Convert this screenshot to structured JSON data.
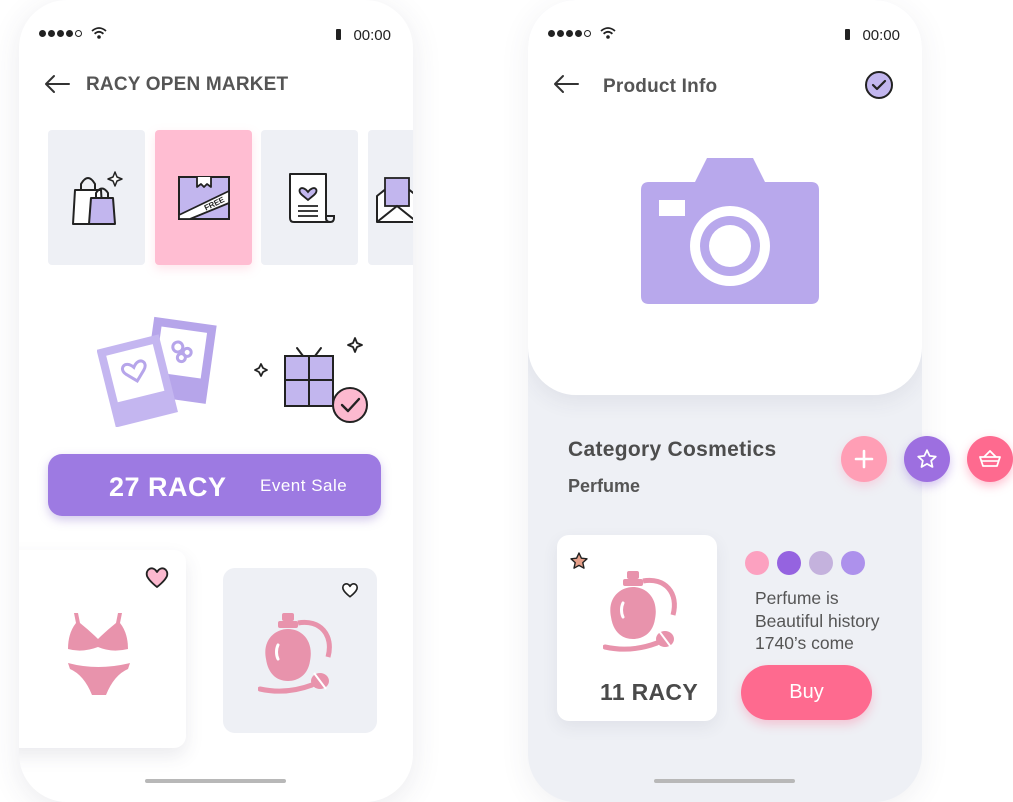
{
  "status_bar": {
    "time": "00:00"
  },
  "market_screen": {
    "title": "RACY OPEN MARKET",
    "categories": [
      {
        "icon": "shopping-bags-icon"
      },
      {
        "icon": "free-box-icon",
        "selected": true
      },
      {
        "icon": "love-letter-icon"
      },
      {
        "icon": "envelope-icon"
      }
    ],
    "promo": {
      "amount": "27 RACY",
      "label": "Event Sale"
    },
    "products": [
      {
        "icon": "bikini-icon",
        "liked": true
      },
      {
        "icon": "perfume-icon",
        "liked": false
      }
    ]
  },
  "product_screen": {
    "title": "Product Info",
    "category_title": "Category Cosmetics",
    "subcategory": "Perfume",
    "price": "11 RACY",
    "description": [
      "Perfume is",
      "Beautiful history",
      "1740’s come"
    ],
    "buy_label": "Buy",
    "color_options": [
      "#fca1c0",
      "#9563e0",
      "#c4b2dd",
      "#ad91ec"
    ]
  },
  "colors": {
    "accent_purple": "#9d7ae2",
    "accent_pink": "#fe6a8f",
    "product_pink": "#e893ac",
    "camera_purple": "#b8a8ec"
  }
}
